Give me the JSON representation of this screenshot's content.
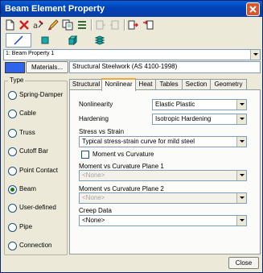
{
  "window": {
    "title": "Beam Element Property"
  },
  "toolbar": {
    "icons": [
      "new-icon",
      "delete-icon",
      "rename-icon",
      "edit-icon",
      "copy-icon",
      "list-icon",
      "import-icon",
      "export-icon",
      "export-to-icon",
      "import-from-icon"
    ],
    "display_icons": [
      "line-display-icon",
      "solid-square-icon",
      "solid-cube-icon",
      "layered-icon"
    ]
  },
  "property_selector": {
    "value": "1: Beam Property 1"
  },
  "materials": {
    "button_label": "Materials...",
    "value": "Structural Steelwork (AS 4100-1998)",
    "swatch_color": "#2f63ea"
  },
  "type_group": {
    "legend": "Type",
    "options": [
      {
        "label": "Spring-Damper",
        "selected": false
      },
      {
        "label": "Cable",
        "selected": false
      },
      {
        "label": "Truss",
        "selected": false
      },
      {
        "label": "Cutoff Bar",
        "selected": false
      },
      {
        "label": "Point Contact",
        "selected": false
      },
      {
        "label": "Beam",
        "selected": true
      },
      {
        "label": "User-defined",
        "selected": false
      },
      {
        "label": "Pipe",
        "selected": false
      },
      {
        "label": "Connection",
        "selected": false
      }
    ]
  },
  "tabs": [
    {
      "label": "Structural",
      "active": false
    },
    {
      "label": "Nonlinear",
      "active": true
    },
    {
      "label": "Heat",
      "active": false
    },
    {
      "label": "Tables",
      "active": false
    },
    {
      "label": "Section",
      "active": false
    },
    {
      "label": "Geometry",
      "active": false
    }
  ],
  "nonlinear": {
    "nonlinearity_label": "Nonlinearity",
    "nonlinearity_value": "Elastic Plastic",
    "hardening_label": "Hardening",
    "hardening_value": "Isotropic Hardening",
    "stress_strain_label": "Stress vs Strain",
    "stress_strain_value": "Typical stress-strain curve for mild steel",
    "moment_curvature_label": "Moment vs Curvature",
    "moment_curvature_checked": false,
    "plane1_label": "Moment vs Curvature Plane 1",
    "plane1_value": "<None>",
    "plane2_label": "Moment vs Curvature Plane 2",
    "plane2_value": "<None>",
    "creep_label": "Creep Data",
    "creep_value": "<None>"
  },
  "footer": {
    "close_label": "Close"
  }
}
